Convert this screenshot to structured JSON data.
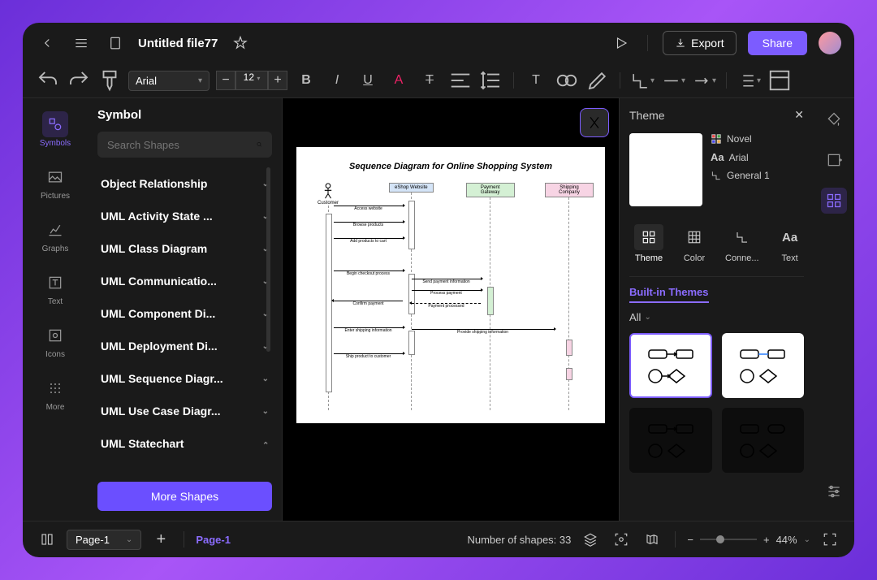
{
  "topbar": {
    "title": "Untitled file77",
    "export_label": "Export",
    "share_label": "Share"
  },
  "toolbar": {
    "font": "Arial",
    "size": "12"
  },
  "rail": {
    "symbols": "Symbols",
    "pictures": "Pictures",
    "graphs": "Graphs",
    "text": "Text",
    "icons": "Icons",
    "more": "More"
  },
  "shapes_panel": {
    "title": "Symbol",
    "search_placeholder": "Search Shapes",
    "categories": [
      "Object Relationship",
      "UML Activity State ...",
      "UML Class Diagram",
      "UML Communicatio...",
      "UML Component Di...",
      "UML Deployment Di...",
      "UML Sequence Diagr...",
      "UML Use Case Diagr...",
      "UML Statechart"
    ],
    "more_shapes": "More Shapes"
  },
  "diagram": {
    "title": "Sequence Diagram for Online Shopping System",
    "lifelines": {
      "customer": "Customer",
      "site": "eShop Website",
      "gateway": "Payment Gateway",
      "shipping": "Shipping Company"
    },
    "messages": [
      "Access website",
      "Browse products",
      "Add products to cart",
      "Begin checkout process",
      "Send payment information",
      "Process payment",
      "Confirm payment",
      "Payment processed",
      "Enter shipping information",
      "Provide shipping information",
      "Ship product to customer"
    ]
  },
  "theme_panel": {
    "title": "Theme",
    "color_scheme": "Novel",
    "font": "Arial",
    "connector": "General 1",
    "tabs": {
      "theme": "Theme",
      "color": "Color",
      "connector_tab": "Conne...",
      "text": "Text"
    },
    "builtin_label": "Built-in Themes",
    "all_label": "All"
  },
  "footer": {
    "page_current": "Page-1",
    "page_tab": "Page-1",
    "shape_count_label": "Number of shapes:",
    "shape_count": "33",
    "zoom": "44%"
  }
}
